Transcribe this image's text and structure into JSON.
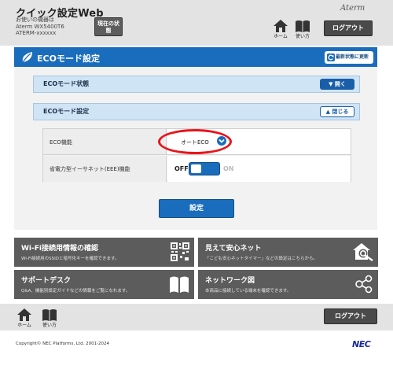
{
  "header": {
    "title": "クイック設定Web",
    "device_line1": "お使いの機器は",
    "device_line2": "Aterm WX5400T6",
    "device_line3": "ATERM-xxxxxx",
    "status_button": "現在の状態",
    "brand": "Aterm",
    "nav": {
      "home": "ホーム",
      "usage": "使い方"
    },
    "logout": "ログアウト"
  },
  "banner": {
    "title": "ECOモード設定",
    "refresh": "最新状態に更新"
  },
  "sections": [
    {
      "label": "ECOモード状態",
      "button": "開く"
    },
    {
      "label": "ECOモード設定",
      "button": "閉じる"
    }
  ],
  "settings": [
    {
      "label": "ECO機能",
      "value": "オートECO"
    },
    {
      "label": "省電力型イーサネット(EEE)機能",
      "off_label": "OFF",
      "on_label": "ON",
      "state": "ON"
    }
  ],
  "apply_button": "設定",
  "tiles": [
    {
      "title": "Wi-Fi接続用情報の確認",
      "subtitle": "Wi-Fi接続用のSSIDと暗号化キーを確認できます。",
      "icon": "qr-code-icon"
    },
    {
      "title": "見えて安心ネット",
      "subtitle": "「こども安心ネットタイマー」などの設定はこちらから。",
      "icon": "home-search-icon"
    },
    {
      "title": "サポートデスク",
      "subtitle": "Q&A、機能別設定ガイドなどの情報をご覧になれます。",
      "icon": "book-icon"
    },
    {
      "title": "ネットワーク図",
      "subtitle": "本商品に接続している端末を確認できます。",
      "icon": "network-icon"
    }
  ],
  "footer": {
    "nav": {
      "home": "ホーム",
      "usage": "使い方"
    },
    "logout": "ログアウト",
    "copyright": "Copyright© NEC Platforms, Ltd. 2001-2024",
    "brand": "NEC"
  },
  "colors": {
    "primary": "#1a6dbc",
    "section_bg": "#cfe4f5",
    "tile_bg": "#5c5c5c",
    "highlight": "#e8141a"
  }
}
